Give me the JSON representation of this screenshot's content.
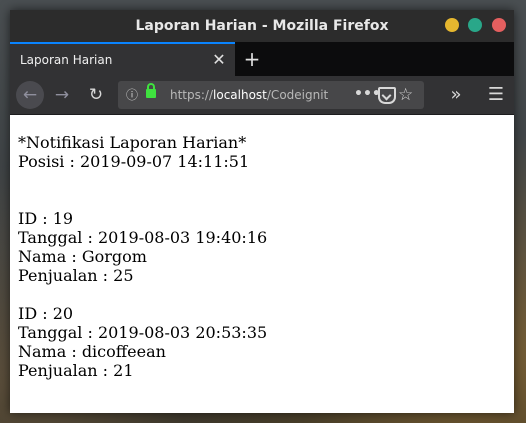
{
  "window": {
    "title": "Laporan Harian - Mozilla Firefox"
  },
  "tabs": [
    {
      "label": "Laporan Harian",
      "close": "✕"
    }
  ],
  "new_tab": "+",
  "navbar": {
    "url_scheme": "https://",
    "url_host": "localhost",
    "url_path": "/Codeignit",
    "more": "•••"
  },
  "report": {
    "heading": "*Notifikasi Laporan Harian*",
    "position": "Posisi : 2019-09-07 14:11:51",
    "entries": [
      {
        "id": "ID : 19",
        "date": "Tanggal : 2019-08-03 19:40:16",
        "name": "Nama : Gorgom",
        "sales": "Penjualan : 25"
      },
      {
        "id": "ID : 20",
        "date": "Tanggal : 2019-08-03 20:53:35",
        "name": "Nama : dicoffeean",
        "sales": "Penjualan : 21"
      }
    ]
  },
  "colors": {
    "titlebar": "#2c2c2c",
    "tab_active_border": "#0a84ff",
    "toolbar": "#323234",
    "lock": "#3fe13f",
    "btn_minimize": "#e6b72f",
    "btn_maximize": "#29a789",
    "btn_close": "#e45f5f"
  }
}
